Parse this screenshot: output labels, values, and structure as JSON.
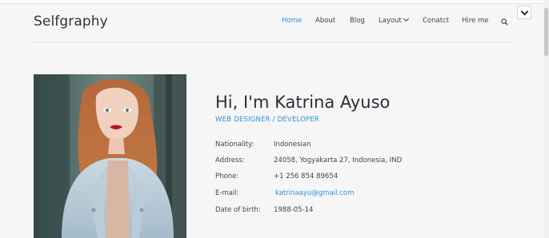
{
  "brand": "Selfgraphy",
  "nav": [
    "Home",
    "About",
    "Blog",
    "Layout",
    "Conatct",
    "Hire me"
  ],
  "hero": {
    "name": "Hi, I'm Katrina Ayuso",
    "role": "WEB DESIGNER / DEVELOPER"
  },
  "details": [
    {
      "label": "Nationality:",
      "value": "Indonesian"
    },
    {
      "label": "Address:",
      "value": "24058, Yogyakarta 27, Indonesia, IND"
    },
    {
      "label": "Phone:",
      "value": "+1 256 854 89654"
    },
    {
      "label": "E-mail:",
      "value": "katrinaayu@gmail.com"
    },
    {
      "label": "Date of birth:",
      "value": "1988-05-14"
    }
  ],
  "colors": {
    "accent": "#2f8fd8",
    "background": "#f6f6f6",
    "text": "#333333"
  },
  "icons": [
    "search-icon",
    "chevron-down-icon"
  ]
}
